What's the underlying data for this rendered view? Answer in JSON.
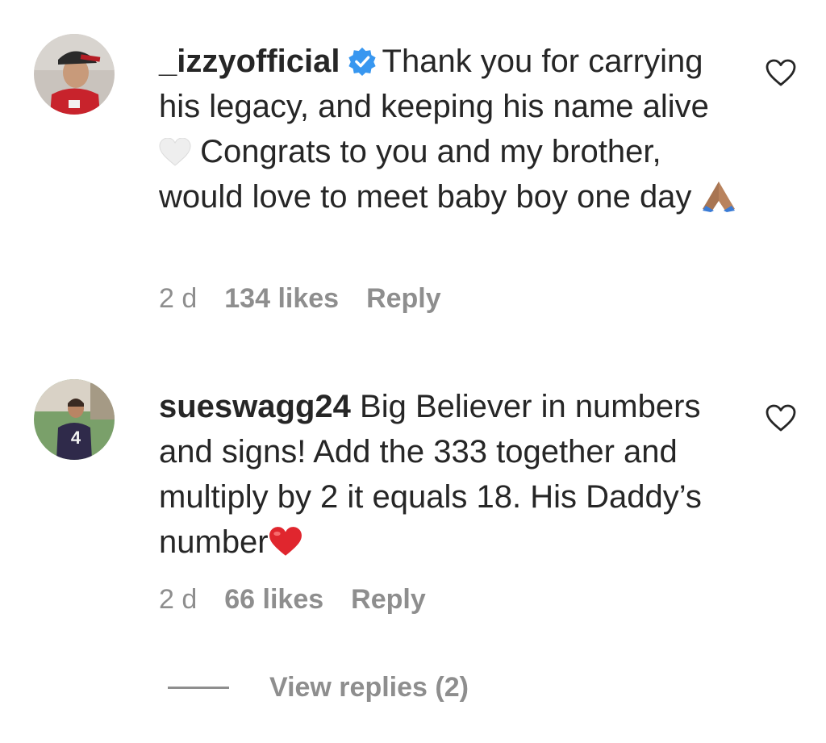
{
  "comments": [
    {
      "username": "_izzyofficial",
      "verified": true,
      "segments": [
        "Thank you for carrying his legacy, and keeping his name alive",
        "Congrats to you and my brother, would love to meet baby boy one day"
      ],
      "emojis": [
        "white-heart",
        "folded-hands"
      ],
      "time": "2 d",
      "likes": "134 likes",
      "reply_label": "Reply"
    },
    {
      "username": "sueswagg24",
      "verified": false,
      "text": "Big Believer in numbers and signs! Add the 333 together and multiply by 2 it equals 18. His Daddy’s number",
      "emojis": [
        "red-heart"
      ],
      "time": "2 d",
      "likes": "66 likes",
      "reply_label": "Reply"
    }
  ],
  "view_replies_label": "View replies (2)",
  "colors": {
    "text": "#262626",
    "muted": "#8e8e8e",
    "verified_blue": "#3897f0",
    "red_heart": "#e0262e"
  }
}
